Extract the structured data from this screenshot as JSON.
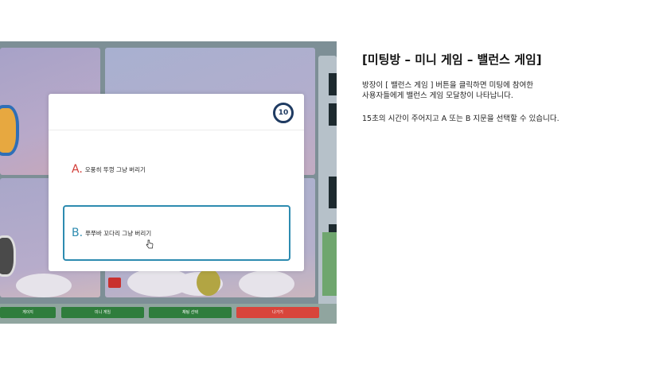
{
  "modal": {
    "timer": "10",
    "option_a": {
      "letter": "A.",
      "text": "오풍히 뚜껑 그냥 버리기"
    },
    "option_b": {
      "letter": "B.",
      "text": "쭈쭈바 꼬다리 그냥 버리기"
    }
  },
  "bottom_bar": {
    "buttons": [
      "게이지",
      "미니 게임",
      "채팅 선택",
      "나가기"
    ]
  },
  "description": {
    "title": "[미팅방 – 미니 게임 – 밸런스 게임]",
    "lines": [
      "방장이 [ 밸런스 게임 ] 버튼을 클릭하면 미팅에 참여한",
      "사용자들에게 밸런스 게임 모달창이 나타납니다.",
      "15초의 시간이 주어지고 A 또는 B 지문을 선택할 수 있습니다."
    ]
  },
  "colors": {
    "accent_blue": "#2d8bb0",
    "accent_red": "#d23b36",
    "timer_navy": "#1f3b62",
    "button_green": "#2f7d3c",
    "button_red": "#d8453b"
  }
}
